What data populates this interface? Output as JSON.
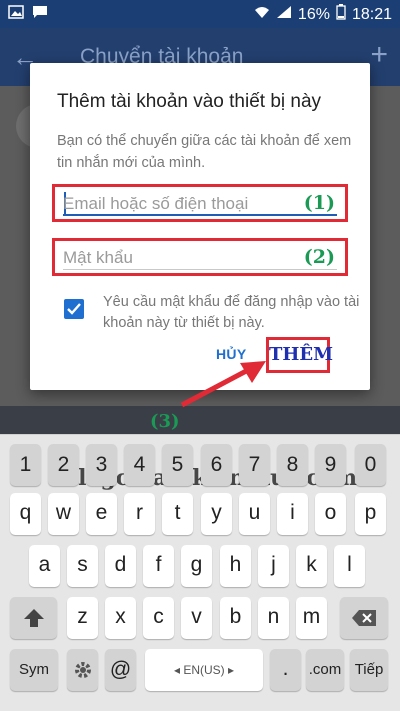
{
  "status_bar": {
    "battery": "16%",
    "time": "18:21",
    "icons": [
      "photo-icon",
      "message-icon",
      "wifi-icon",
      "signal-icon",
      "battery-icon"
    ]
  },
  "app_bar": {
    "title": "Chuyển tài khoản",
    "back_icon": "arrow-left-icon",
    "add_icon": "plus-icon"
  },
  "dialog": {
    "title": "Thêm tài khoản vào thiết bị này",
    "description": "Bạn có thể chuyển giữa các tài khoản để xem tin nhắn mới của mình.",
    "email_placeholder": "Email hoặc số điện thoại",
    "email_marker": "(1)",
    "password_placeholder": "Mật khẩu",
    "password_marker": "(2)",
    "checkbox_label": "Yêu cầu mật khẩu để đăng nhập vào tài khoản này từ thiết bị này.",
    "checkbox_checked": true,
    "cancel_label": "HỦY",
    "add_label": "THÊM"
  },
  "annotation": {
    "step_label": "(3)"
  },
  "watermark": "blogchiasekienthuc.com",
  "keyboard": {
    "row_numbers": [
      "1",
      "2",
      "3",
      "4",
      "5",
      "6",
      "7",
      "8",
      "9",
      "0"
    ],
    "row1": [
      "q",
      "w",
      "e",
      "r",
      "t",
      "y",
      "u",
      "i",
      "o",
      "p"
    ],
    "row2": [
      "a",
      "s",
      "d",
      "f",
      "g",
      "h",
      "j",
      "k",
      "l"
    ],
    "row3": [
      "z",
      "x",
      "c",
      "v",
      "b",
      "n",
      "m"
    ],
    "row4": {
      "sym": "Sym",
      "at": "@",
      "space": "EN(US)",
      "period": ".",
      "dotcom": ".com",
      "next": "Tiếp"
    }
  },
  "colors": {
    "accent": "#1f6fd0",
    "annotation_red": "#e02a35",
    "annotation_green": "#1a9a55"
  }
}
